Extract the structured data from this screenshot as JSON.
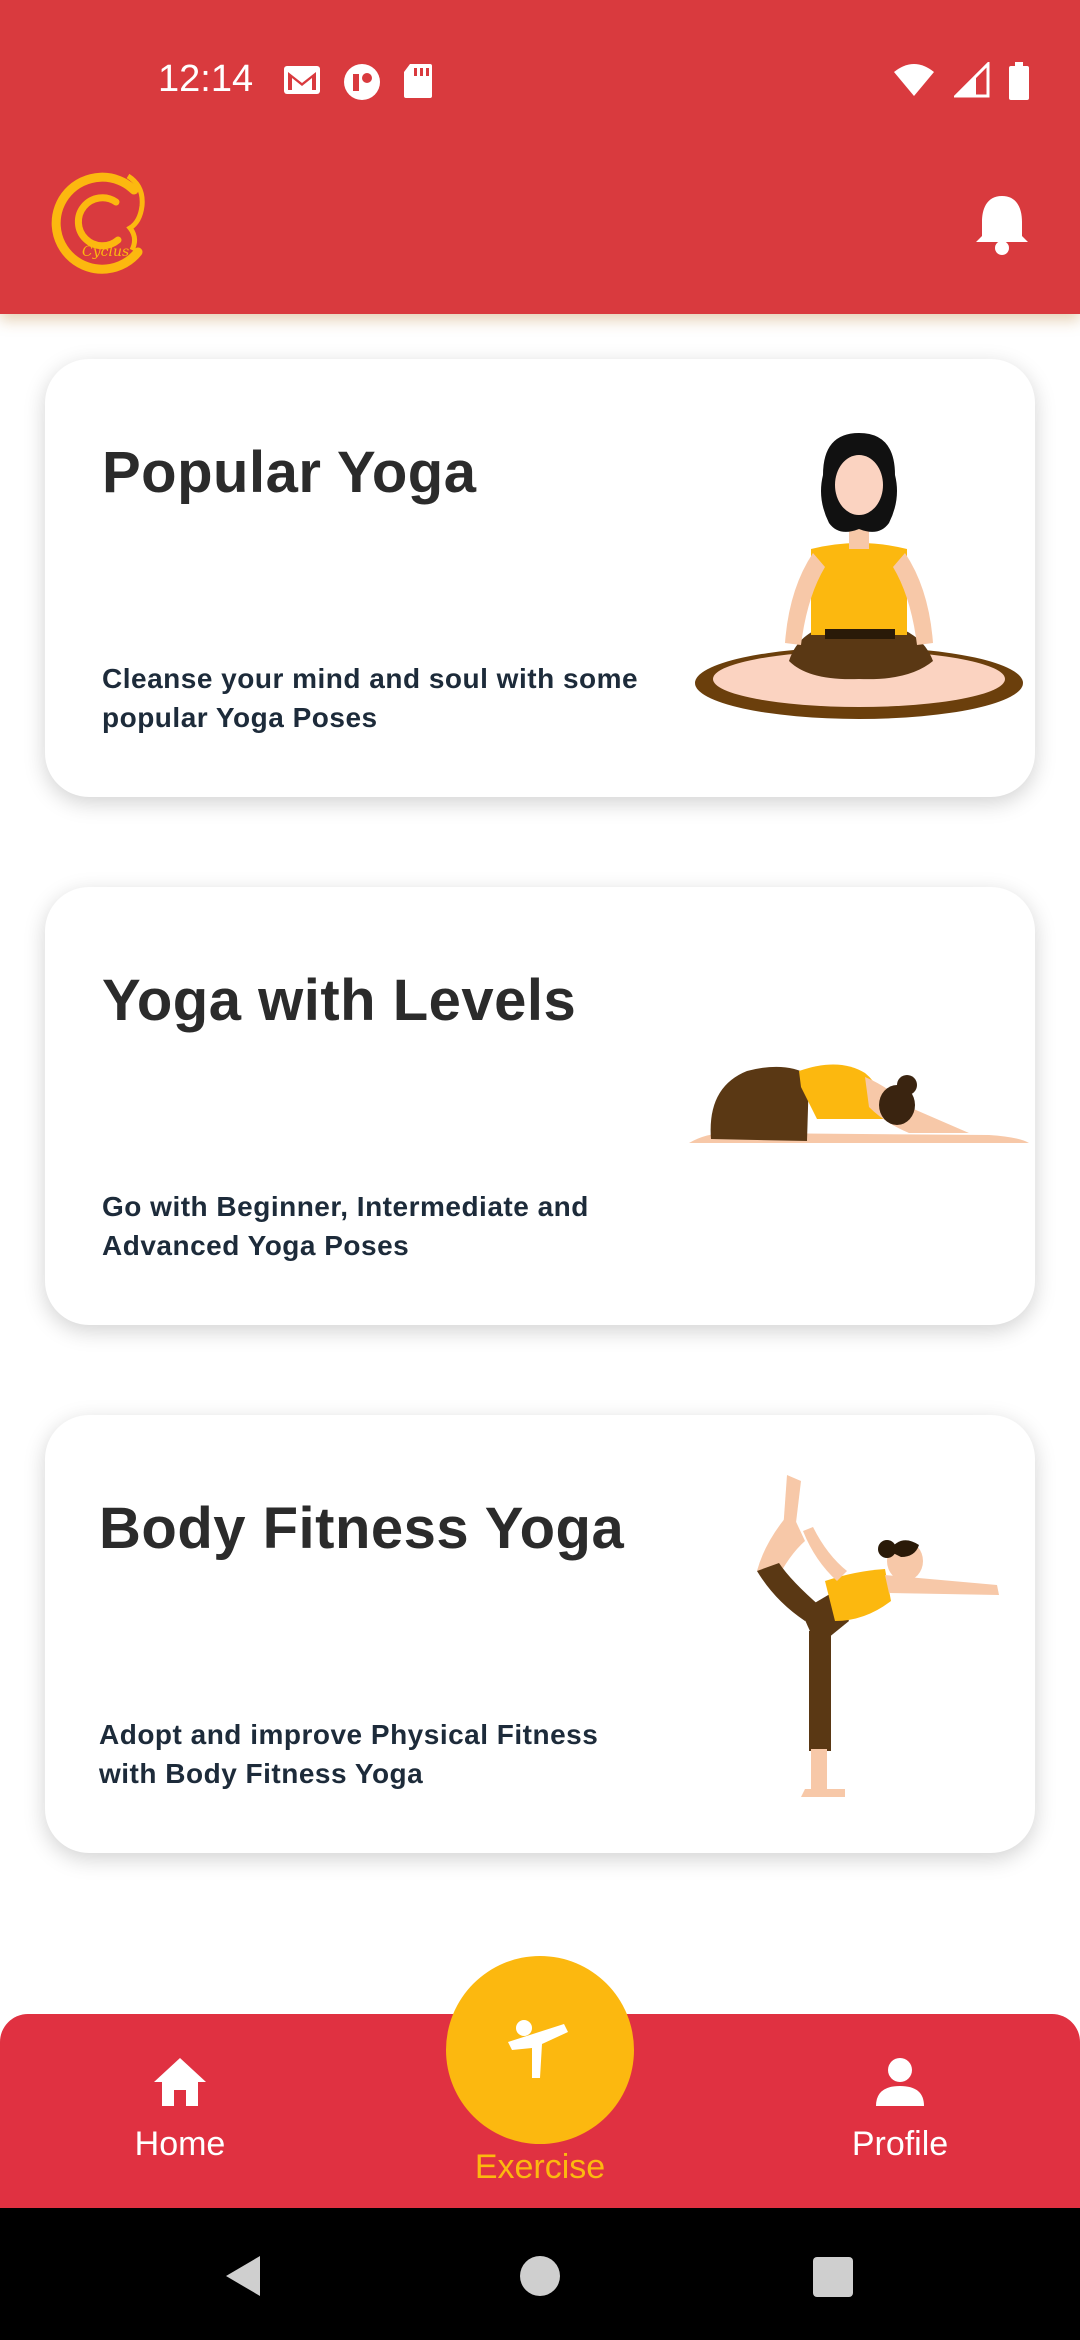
{
  "status_bar": {
    "time": "12:14",
    "left_icons": [
      "gmail-icon",
      "app-notification-icon",
      "sd-card-icon"
    ],
    "right_icons": [
      "wifi-icon",
      "signal-icon",
      "battery-icon"
    ]
  },
  "app_bar": {
    "logo_text": "Cyclus",
    "logo_icon": "cyclus-logo",
    "notification_icon": "bell-icon",
    "colors": {
      "background": "#d93a3e",
      "accent": "#fcb80f"
    }
  },
  "cards": [
    {
      "title": "Popular Yoga",
      "subtitle": "Cleanse your mind and soul with some popular Yoga Poses",
      "illustration": "meditation-pose-illustration"
    },
    {
      "title": "Yoga with Levels",
      "subtitle": "Go with Beginner, Intermediate and Advanced Yoga Poses",
      "illustration": "child-pose-illustration"
    },
    {
      "title": "Body Fitness Yoga",
      "subtitle": "Adopt and improve Physical Fitness with Body Fitness Yoga",
      "illustration": "dancer-pose-illustration"
    }
  ],
  "bottom_nav": {
    "items": [
      {
        "label": "Home",
        "icon": "home-icon"
      },
      {
        "label": "Exercise",
        "icon": "exercise-icon",
        "active": true
      },
      {
        "label": "Profile",
        "icon": "person-icon"
      }
    ],
    "colors": {
      "background": "#e03141",
      "active": "#fcb80f"
    }
  },
  "system_nav": [
    "back-icon",
    "home-circle-icon",
    "recents-icon"
  ]
}
